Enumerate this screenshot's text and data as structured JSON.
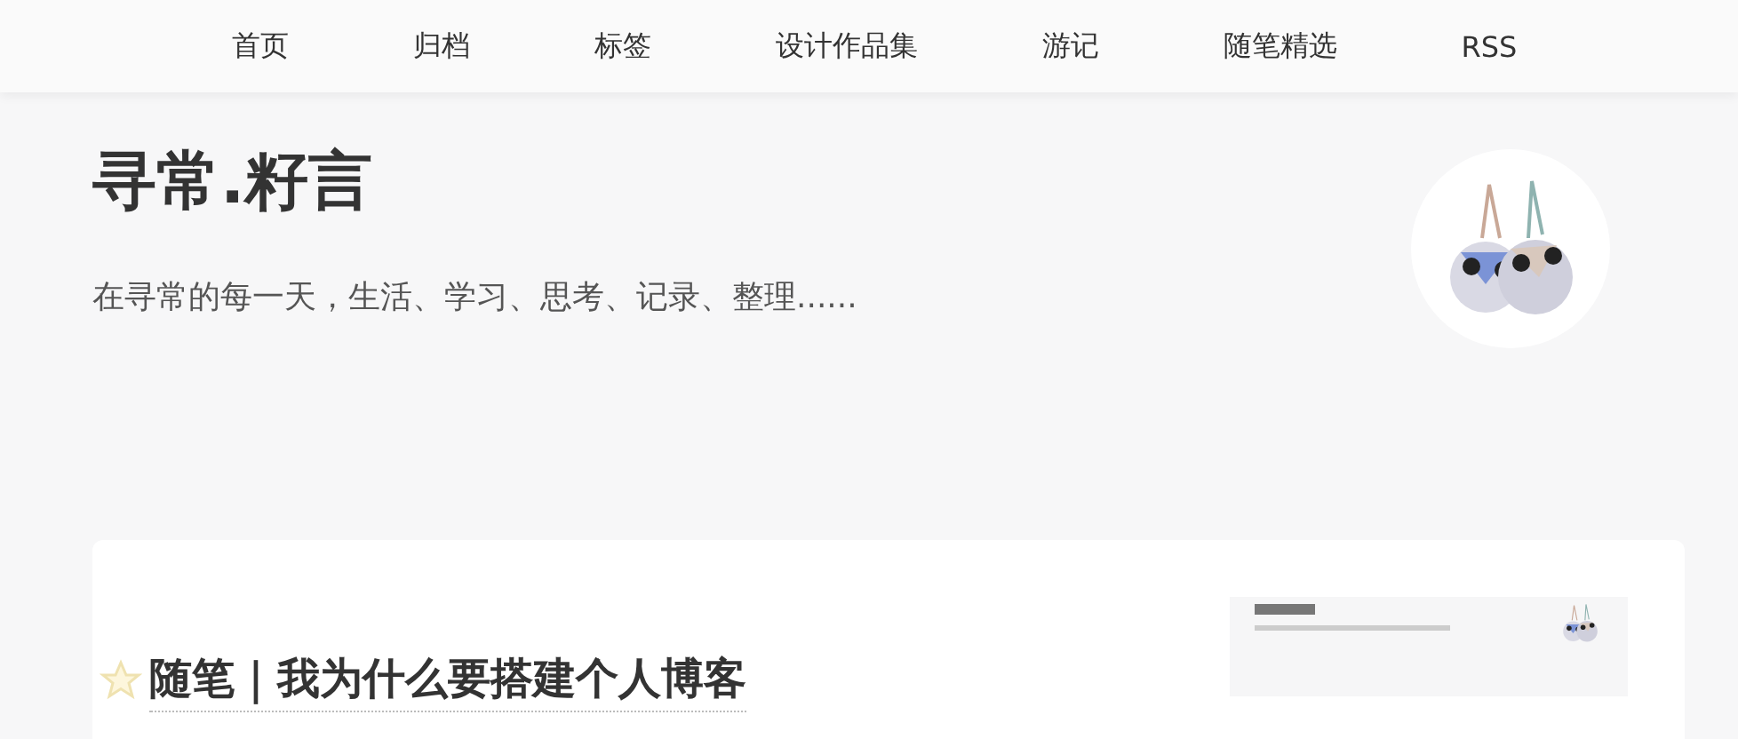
{
  "nav": {
    "items": [
      {
        "label": "首页"
      },
      {
        "label": "归档"
      },
      {
        "label": "标签"
      },
      {
        "label": "设计作品集"
      },
      {
        "label": "游记"
      },
      {
        "label": "随笔精选"
      },
      {
        "label": "RSS"
      }
    ]
  },
  "header": {
    "title": "寻常.籽言",
    "subtitle": "在寻常的每一天，生活、学习、思考、记录、整理......"
  },
  "posts": [
    {
      "title": "随笔｜我为什么要搭建个人博客",
      "starred": true
    }
  ]
}
